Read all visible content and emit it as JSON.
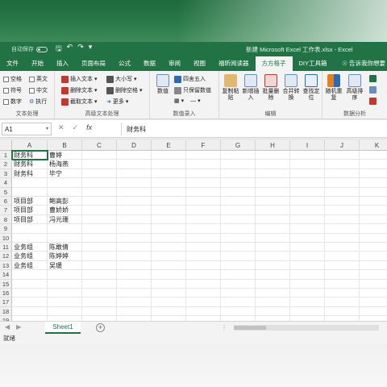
{
  "window": {
    "autosave_label": "自动保存",
    "title": "新建 Microsoft Excel 工作表.xlsx  -  Excel"
  },
  "tabs": [
    "文件",
    "开始",
    "插入",
    "页面布局",
    "公式",
    "数据",
    "审阅",
    "视图",
    "福昕阅读器",
    "方方格子",
    "DIY工具箱"
  ],
  "active_tab": "方方格子",
  "tell_me": "告诉我你想要",
  "ribbon": {
    "text_group": {
      "label": "文本处理",
      "options": [
        "空格",
        "英文",
        "符号",
        "中文",
        "数字",
        "执行"
      ]
    },
    "advanced_group": {
      "label": "高级文本处理",
      "buttons": [
        "插入文本",
        "删除文本",
        "截取文本",
        "大小写",
        "删除空格",
        "更多"
      ]
    },
    "numeric_group": {
      "label": "数值录入",
      "buttons": [
        "数值",
        "四舍五入",
        "只保留数值"
      ]
    },
    "edit_group": {
      "label": "编辑",
      "buttons": [
        "复制粘贴",
        "新增插入",
        "批量删除",
        "合并转换",
        "查找定位"
      ]
    },
    "analysis_group": {
      "label": "数据分析",
      "buttons": [
        "随机重复",
        "高级排序"
      ]
    }
  },
  "formula_bar": {
    "name_box": "A1",
    "formula": "财务科"
  },
  "columns": [
    "A",
    "B",
    "C",
    "D",
    "E",
    "F",
    "G",
    "H",
    "I",
    "J",
    "K"
  ],
  "rows": [
    {
      "n": "1",
      "a": "财务科",
      "b": "曹婷"
    },
    {
      "n": "2",
      "a": "财务科",
      "b": "杨海燕"
    },
    {
      "n": "3",
      "a": "财务科",
      "b": "毕宁"
    },
    {
      "n": "4",
      "a": "",
      "b": ""
    },
    {
      "n": "5",
      "a": "",
      "b": ""
    },
    {
      "n": "6",
      "a": "项目部",
      "b": "鲍高彭"
    },
    {
      "n": "7",
      "a": "项目部",
      "b": "曹娇娇"
    },
    {
      "n": "8",
      "a": "项目部",
      "b": "冯元珊"
    },
    {
      "n": "9",
      "a": "",
      "b": ""
    },
    {
      "n": "10",
      "a": "",
      "b": ""
    },
    {
      "n": "11",
      "a": "业务组",
      "b": "陈敢倩"
    },
    {
      "n": "12",
      "a": "业务组",
      "b": "陈婷婷"
    },
    {
      "n": "13",
      "a": "业务组",
      "b": "吴瑗"
    },
    {
      "n": "14",
      "a": "",
      "b": ""
    },
    {
      "n": "15",
      "a": "",
      "b": ""
    },
    {
      "n": "16",
      "a": "",
      "b": ""
    },
    {
      "n": "17",
      "a": "",
      "b": ""
    },
    {
      "n": "18",
      "a": "",
      "b": ""
    },
    {
      "n": "19",
      "a": "",
      "b": ""
    }
  ],
  "sheet_tab": "Sheet1",
  "status": "就绪",
  "colors": {
    "excel_green": "#217346"
  }
}
